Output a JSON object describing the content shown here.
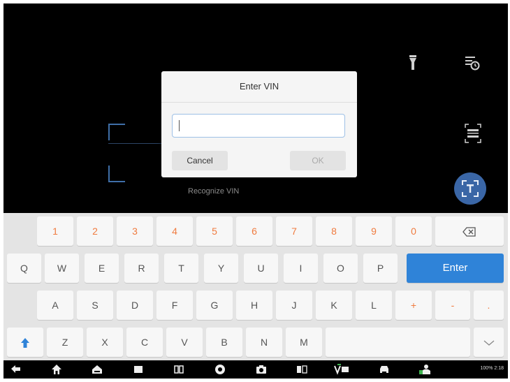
{
  "camera": {
    "recognize_label": "Recognize VIN"
  },
  "dialog": {
    "title": "Enter VIN",
    "vin_value": "",
    "cancel_label": "Cancel",
    "ok_label": "OK"
  },
  "keyboard": {
    "number_row": [
      "1",
      "2",
      "3",
      "4",
      "5",
      "6",
      "7",
      "8",
      "9",
      "0"
    ],
    "row1": [
      "Q",
      "W",
      "E",
      "R",
      "T",
      "Y",
      "U",
      "I",
      "O",
      "P"
    ],
    "row2": [
      "A",
      "S",
      "D",
      "F",
      "G",
      "H",
      "J",
      "K",
      "L",
      "+",
      "-",
      "."
    ],
    "row3": [
      "Z",
      "X",
      "C",
      "V",
      "B",
      "N",
      "M"
    ],
    "enter_label": "Enter"
  },
  "status": {
    "text": "100%  2:18"
  },
  "icons": [
    "flashlight-icon",
    "history-icon",
    "barcode-scan-icon",
    "ocr-icon",
    "backspace-icon",
    "shift-icon",
    "hide-keyboard-icon",
    "back-icon",
    "home-icon",
    "car-home-icon",
    "recent-apps-icon",
    "split-screen-icon",
    "browser-icon",
    "camera-icon",
    "screen-mirror-icon",
    "vcmi-icon",
    "car-icon",
    "remote-expert-icon"
  ],
  "colors": {
    "accent": "#2f83d8",
    "number_key": "#f07b3f",
    "ocr_button": "#3a66a6"
  }
}
